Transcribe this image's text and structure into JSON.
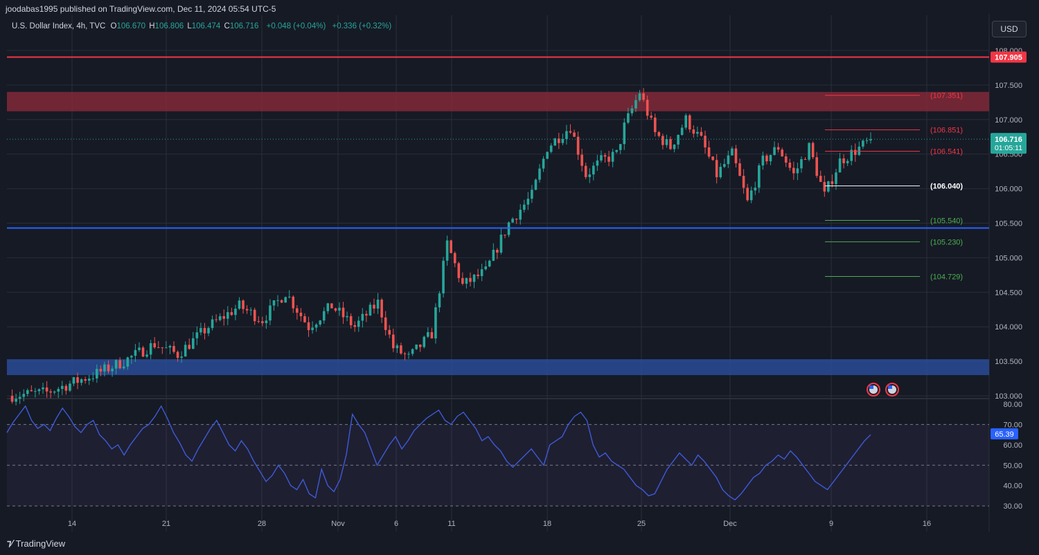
{
  "header": {
    "published_line": "joodabas1995 published on TradingView.com, Dec 11, 2024 05:54 UTC-5"
  },
  "legend": {
    "symbol": "U.S. Dollar Index, 4h, TVC",
    "o_label": "O",
    "o_value": "106.670",
    "h_label": "H",
    "h_value": "106.806",
    "l_label": "L",
    "l_value": "106.474",
    "c_label": "C",
    "c_value": "106.716",
    "change_1": "+0.048 (+0.04%)",
    "change_2": "+0.336 (+0.32%)"
  },
  "currency_button": "USD",
  "brand": {
    "icon": "tradingview-logo-icon",
    "name": "TradingView"
  },
  "colors": {
    "background": "#161a25",
    "grid": "#2a2e39",
    "text": "#b2b5be",
    "up": "#26a69a",
    "down": "#ef5350",
    "resistance_line": "#f23645",
    "support_line": "#2962ff",
    "supply_zone": "#8f2b3b",
    "demand_zone": "#2a4f9e",
    "rsi_line": "#3d5bd6",
    "rsi_band": "#7e57c2"
  },
  "chart_data": [
    {
      "type": "candlestick",
      "interval": "4h",
      "ylim": [
        102.98,
        108.15
      ],
      "y_ticks": [
        "108.000",
        "107.500",
        "107.000",
        "106.500",
        "106.000",
        "105.500",
        "105.000",
        "104.500",
        "104.000",
        "103.500",
        "103.000"
      ],
      "x_ticks": [
        "14",
        "21",
        "28",
        "Nov",
        "6",
        "11",
        "18",
        "25",
        "Dec",
        "9",
        "16"
      ],
      "close_path": [
        [
          0,
          103.0
        ],
        [
          10,
          103.05
        ],
        [
          22,
          103.3
        ],
        [
          30,
          103.5
        ],
        [
          38,
          103.75
        ],
        [
          44,
          103.6
        ],
        [
          52,
          104.0
        ],
        [
          60,
          104.3
        ],
        [
          66,
          104.1
        ],
        [
          72,
          104.5
        ],
        [
          78,
          104.0
        ],
        [
          84,
          104.3
        ],
        [
          90,
          104.0
        ],
        [
          96,
          104.35
        ],
        [
          100,
          103.7
        ],
        [
          104,
          103.55
        ],
        [
          110,
          103.9
        ],
        [
          114,
          105.2
        ],
        [
          118,
          104.6
        ],
        [
          124,
          104.8
        ],
        [
          130,
          105.5
        ],
        [
          136,
          105.9
        ],
        [
          140,
          106.6
        ],
        [
          146,
          106.9
        ],
        [
          150,
          106.2
        ],
        [
          154,
          106.4
        ],
        [
          158,
          106.5
        ],
        [
          160,
          106.9
        ],
        [
          164,
          107.4
        ],
        [
          168,
          106.8
        ],
        [
          172,
          106.6
        ],
        [
          176,
          107.0
        ],
        [
          180,
          106.7
        ],
        [
          184,
          106.2
        ],
        [
          188,
          106.5
        ],
        [
          192,
          105.8
        ],
        [
          196,
          106.4
        ],
        [
          200,
          106.6
        ],
        [
          204,
          106.2
        ],
        [
          208,
          106.6
        ],
        [
          212,
          105.9
        ],
        [
          216,
          106.4
        ],
        [
          220,
          106.55
        ],
        [
          224,
          106.7
        ]
      ],
      "current_price": "106.716",
      "countdown": "01:05:11",
      "resistance_line": "107.905",
      "support_line": 105.43,
      "supply_zone": [
        107.12,
        107.4
      ],
      "demand_zone": [
        103.3,
        103.53
      ],
      "levels": [
        {
          "label": "(107.351)",
          "value": 107.351,
          "color": "#f23645"
        },
        {
          "label": "(106.851)",
          "value": 106.851,
          "color": "#f23645"
        },
        {
          "label": "(106.541)",
          "value": 106.541,
          "color": "#f23645"
        },
        {
          "label": "(106.040)",
          "value": 106.04,
          "color": "#ffffff"
        },
        {
          "label": "(105.540)",
          "value": 105.54,
          "color": "#4caf50"
        },
        {
          "label": "(105.230)",
          "value": 105.23,
          "color": "#4caf50"
        },
        {
          "label": "(104.729)",
          "value": 104.729,
          "color": "#4caf50"
        }
      ]
    },
    {
      "type": "line",
      "name": "RSI",
      "ylim": [
        27,
        82
      ],
      "y_ticks": [
        "80.00",
        "70.00",
        "60.00",
        "50.00",
        "40.00",
        "30.00"
      ],
      "bands": [
        30,
        50,
        70
      ],
      "current_value": "65.39",
      "values": [
        66,
        71,
        75,
        79,
        72,
        68,
        70,
        67,
        73,
        78,
        74,
        69,
        66,
        70,
        72,
        65,
        62,
        58,
        60,
        55,
        60,
        64,
        68,
        70,
        74,
        79,
        73,
        66,
        61,
        55,
        52,
        58,
        63,
        68,
        72,
        66,
        60,
        57,
        62,
        58,
        52,
        47,
        42,
        45,
        50,
        46,
        40,
        38,
        43,
        36,
        34,
        48,
        40,
        37,
        43,
        55,
        75,
        70,
        66,
        58,
        50,
        55,
        60,
        64,
        58,
        62,
        67,
        70,
        73,
        75,
        77,
        72,
        70,
        74,
        76,
        72,
        68,
        62,
        64,
        60,
        57,
        52,
        49,
        52,
        55,
        58,
        54,
        50,
        60,
        62,
        64,
        70,
        74,
        76,
        72,
        60,
        54,
        56,
        52,
        50,
        48,
        44,
        40,
        38,
        35,
        36,
        42,
        48,
        52,
        56,
        53,
        50,
        55,
        52,
        48,
        44,
        38,
        35,
        33,
        36,
        40,
        44,
        46,
        50,
        52,
        55,
        53,
        57,
        54,
        50,
        46,
        42,
        40,
        38,
        42,
        46,
        50,
        54,
        58,
        62,
        65
      ]
    }
  ],
  "events": [
    {
      "icon": "us-flag-event-icon"
    },
    {
      "icon": "us-flag-event-icon"
    }
  ]
}
